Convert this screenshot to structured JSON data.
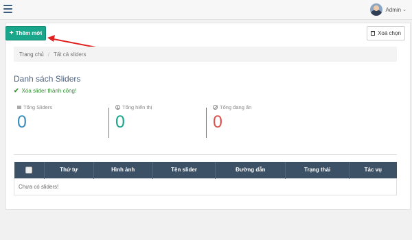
{
  "header": {
    "user_name": "Admin",
    "caret": "⌄"
  },
  "toolbar": {
    "add_icon": "+",
    "add_label": "Thêm mới",
    "delete_label": "Xoá chọn"
  },
  "breadcrumb": {
    "home": "Trang chủ",
    "separator": "/",
    "current": "Tất cả sliders"
  },
  "page": {
    "title": "Danh sách Sliders",
    "success_icon": "✔",
    "success_message": "Xóa slider thành công!"
  },
  "stats": {
    "total": {
      "label": "Tổng Sliders",
      "value": "0",
      "color": "#3c8dbc"
    },
    "shown": {
      "label": "Tổng hiển thị",
      "value": "0",
      "color": "#1aa68b"
    },
    "hidden": {
      "label": "Tổng đang ẩn",
      "value": "0",
      "color": "#d9534f"
    }
  },
  "table": {
    "columns": [
      "Thứ tự",
      "Hình ảnh",
      "Tên slider",
      "Đường dẫn",
      "Trạng thái",
      "Tác vụ"
    ],
    "empty_message": "Chưa có sliders!"
  },
  "colors": {
    "accent": "#1aa68b",
    "table_header": "#3d5166",
    "annotation_arrow": "#e02020"
  }
}
